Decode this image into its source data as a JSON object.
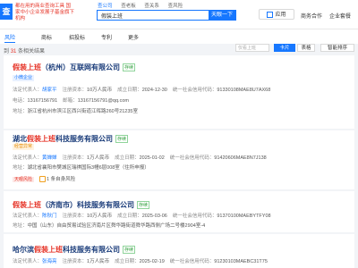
{
  "header": {
    "logo_text": "查",
    "slogan": "都在用的商业查询工具 国家中小企业发展子基金旗下机构",
    "search_tabs": [
      "查公司",
      "查老板",
      "查关系",
      "查风险"
    ],
    "search_value": "假装上班",
    "search_button": "天眼一下",
    "app_button": "应用",
    "nav": [
      "商务合作",
      "企业套餐"
    ]
  },
  "filter_tabs": [
    "风险",
    "商标",
    "招投标",
    "专利",
    "更多"
  ],
  "result_count_prefix": "到",
  "result_count": "31",
  "result_count_suffix": "条相关结果",
  "toolbar": {
    "find_placeholder": "仅看上班",
    "list_button": "卡片",
    "table_button": "表格",
    "sort_button": "智能排序"
  },
  "companies": [
    {
      "name_hl": "假装上班",
      "name_rest": "（杭州）互联网有限公司",
      "status": "存续",
      "tag": "小微企业",
      "rep_label": "法定代表人：",
      "rep": "胡家平",
      "cap_label": "注册资本：",
      "cap": "10万人民币",
      "date_label": "成立日期：",
      "date": "2024-12-30",
      "code_label": "统一社会信用代码：",
      "code": "91330108MAE8U7AX68",
      "phone_label": "电话：",
      "phone": "13167156791",
      "email_label": "邮箱：",
      "email": "13167156791@qq.com",
      "addr_label": "地址：",
      "addr": "浙江省杭州市滨江区西兴街道江晖路260号21235室"
    },
    {
      "name_pre": "湖北",
      "name_hl": "假装上班",
      "name_rest": "科技服务有限公司",
      "status": "存续",
      "tag": "经营异常",
      "rep_label": "法定代表人：",
      "rep": "黄婵婵",
      "cap_label": "注册资本：",
      "cap": "1万人民币",
      "date_label": "成立日期：",
      "date": "2025-01-02",
      "code_label": "统一社会信用代码：",
      "code": "91420606MAE8N7J138",
      "addr_label": "地址：",
      "addr": "湖北省襄阳市樊城区瑞祺国际3幢6层008室（住所申报）",
      "risk_label": "天眼风险",
      "risk_text": "1 条自身风险"
    },
    {
      "name_hl": "假装上班",
      "name_rest": "（济南市）科技服务有限公司",
      "status": "存续",
      "rep_label": "法定代表人：",
      "rep": "陈秋门",
      "cap_label": "注册资本：",
      "cap": "10万人民币",
      "date_label": "成立日期：",
      "date": "2025-03-06",
      "code_label": "统一社会信用代码：",
      "code": "91370100MAEBYTFY08",
      "addr_label": "地址：",
      "addr": "中国（山东）自由贸易试验区济南片区舜华路街道舜华路西侧广场二号楼2904室-4"
    },
    {
      "name_pre": "哈尔滨",
      "name_hl": "假装上班",
      "name_rest": "科技服务有限公司",
      "status": "存续",
      "rep_label": "法定代表人：",
      "rep": "张海亮",
      "cap_label": "注册资本：",
      "cap": "1万人民币",
      "date_label": "成立日期：",
      "date": "2025-02-19",
      "code_label": "统一社会信用代码：",
      "code": "91230103MAEBC31T75"
    }
  ]
}
